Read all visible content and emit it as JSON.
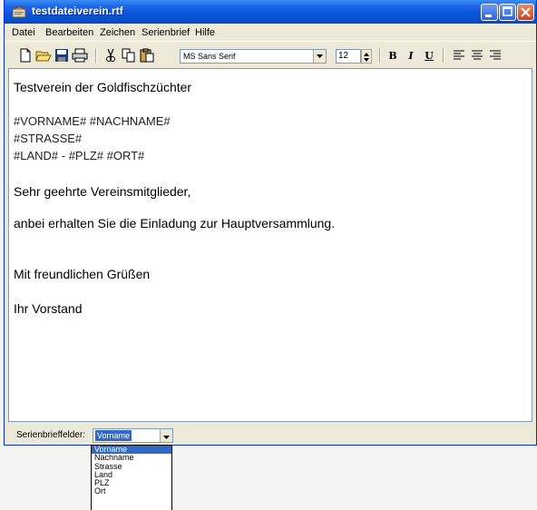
{
  "window": {
    "title": "testdateiverein.rtf"
  },
  "menu": [
    "Datei",
    "Bearbeiten",
    "Zeichen",
    "Serienbrief",
    "Hilfe"
  ],
  "toolbar": {
    "font_name": "MS Sans Serif",
    "font_size": "12",
    "bold_label": "B",
    "italic_label": "I",
    "underline_label": "U"
  },
  "document": {
    "lines": [
      "Testverein der Goldfischzüchter",
      "#VORNAME# #NACHNAME#",
      "#STRASSE#",
      "#LAND# - #PLZ# #ORT#",
      "Sehr geehrte Vereinsmitglieder,",
      "anbei erhalten Sie die Einladung zur Hauptversammlung.",
      "Mit freundlichen Grüßen",
      "Ihr Vorstand"
    ]
  },
  "fields": {
    "label": "Serienbrieffelder:",
    "selected": "Vorname",
    "options": [
      "Vorname",
      "Nachname",
      "Strasse",
      "Land",
      "PLZ",
      "Ort"
    ]
  }
}
